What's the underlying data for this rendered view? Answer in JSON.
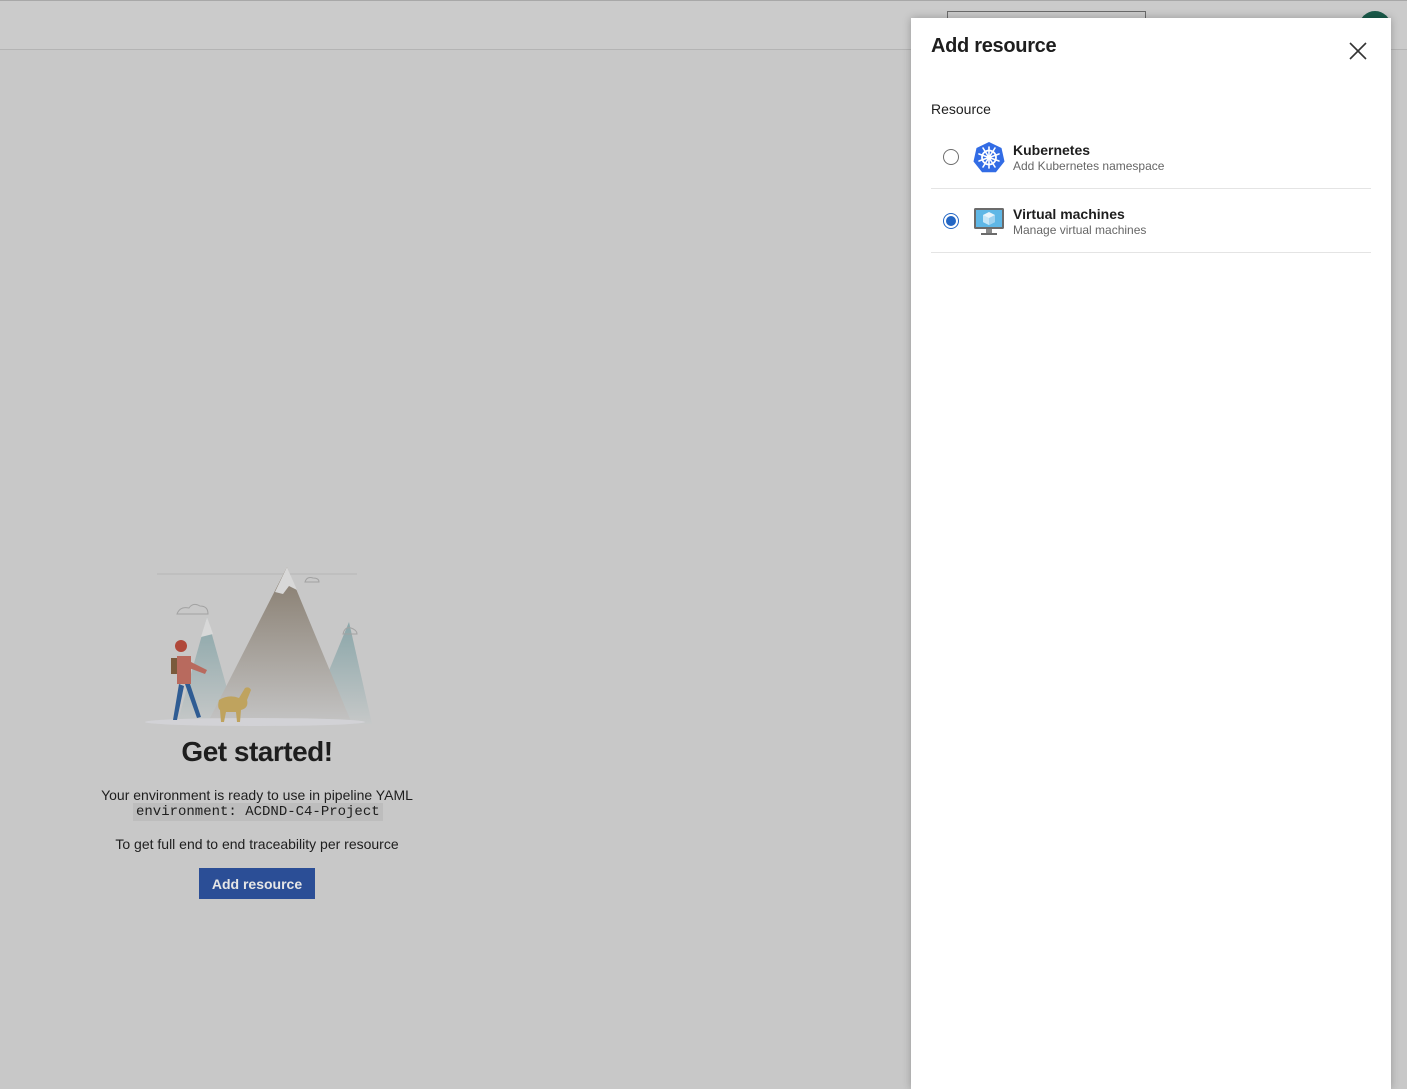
{
  "topbar": {
    "search_placeholder": ""
  },
  "main": {
    "heading": "Get started!",
    "ready_text": "Your environment is ready to use in pipeline YAML",
    "yaml_snippet": "environment: ACDND-C4-Project",
    "traceability_text": "To get full end to end traceability per resource",
    "add_resource_label": "Add resource"
  },
  "panel": {
    "title": "Add resource",
    "close_icon": "close-icon",
    "section_label": "Resource",
    "options": [
      {
        "title": "Kubernetes",
        "subtitle": "Add Kubernetes namespace",
        "icon": "kubernetes-icon",
        "selected": false
      },
      {
        "title": "Virtual machines",
        "subtitle": "Manage virtual machines",
        "icon": "virtual-machine-icon",
        "selected": true
      }
    ]
  },
  "colors": {
    "overlay": "#c8c8c8",
    "primary_button": "#2b4e96",
    "radio_selected": "#2366c4",
    "kubernetes_blue": "#326ce5"
  }
}
